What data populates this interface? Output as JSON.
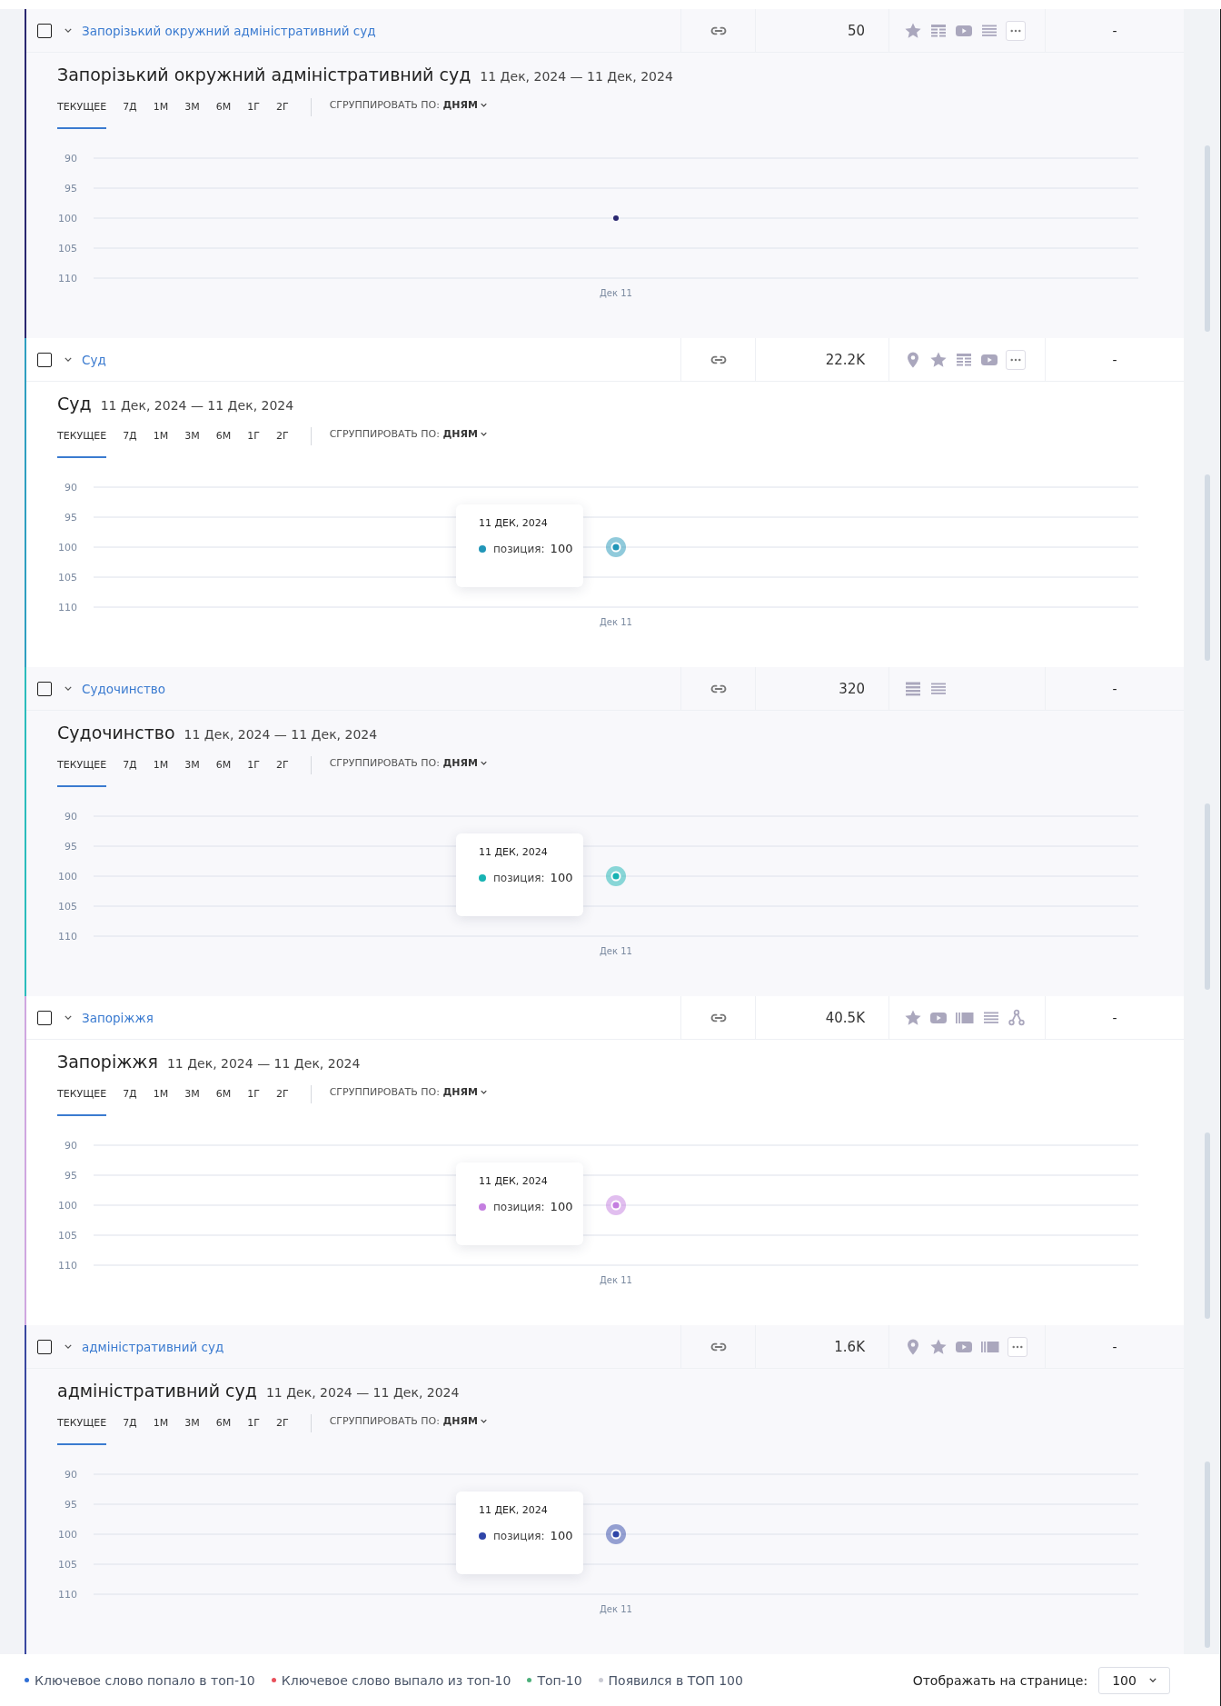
{
  "keywords": [
    {
      "keyword": "Запорізький окружний адміністративний суд",
      "checked": false,
      "expanded": true,
      "volume": "50",
      "features": [
        {
          "kind": "star"
        },
        {
          "kind": "table"
        },
        {
          "kind": "video"
        },
        {
          "kind": "list"
        },
        {
          "kind": "more"
        }
      ],
      "status": "-",
      "color": "#2a2770",
      "title": "Запорізький окружний адміністративний суд",
      "dates": "11 Дек, 2024 — 11 Дек, 2024",
      "periods": [
        {
          "label": "ТЕКУЩЕЕ",
          "selected": true
        },
        {
          "label": "7Д",
          "selected": false
        },
        {
          "label": "1М",
          "selected": false
        },
        {
          "label": "3М",
          "selected": false
        },
        {
          "label": "6М",
          "selected": false
        },
        {
          "label": "1Г",
          "selected": false
        },
        {
          "label": "2Г",
          "selected": false
        }
      ],
      "group_by": "СГРУППИРОВАТЬ ПО: **ДНЯМ**",
      "chart_data": {
        "type": "line",
        "x": [
          "Дек 11"
        ],
        "ylim": [
          110,
          90
        ],
        "yticks": [
          90,
          95,
          100,
          105,
          110
        ],
        "grid": true,
        "series": [
          {
            "color": "#2a2770",
            "marker": true,
            "values": [
              100
            ]
          }
        ]
      }
    },
    {
      "keyword": "Суд",
      "checked": false,
      "expanded": true,
      "volume": "22.2K",
      "features": [
        {
          "kind": "pin"
        },
        {
          "kind": "star"
        },
        {
          "kind": "table"
        },
        {
          "kind": "video"
        },
        {
          "kind": "more"
        }
      ],
      "status": "-",
      "color": "#2f9fc0",
      "title": "Суд",
      "dates": "11 Дек, 2024 — 11 Дек, 2024",
      "periods": [
        {
          "label": "ТЕКУЩЕЕ",
          "selected": true
        },
        {
          "label": "7Д",
          "selected": false
        },
        {
          "label": "1М",
          "selected": false
        },
        {
          "label": "3М",
          "selected": false
        },
        {
          "label": "6М",
          "selected": false
        },
        {
          "label": "1Г",
          "selected": false
        },
        {
          "label": "2Г",
          "selected": false
        }
      ],
      "group_by": "СГРУППИРОВАТЬ ПО: **ДНЯМ**",
      "chart_data": {
        "type": "line",
        "x": [
          "Дек 11"
        ],
        "ylim": [
          110,
          90
        ],
        "yticks": [
          90,
          95,
          100,
          105,
          110
        ],
        "grid": true,
        "series": [
          {
            "color": "#2196b8",
            "marker": true,
            "values": [
              100
            ]
          }
        ]
      },
      "tooltip": {
        "date": "11 ДЕК, 2024",
        "label": "позиция:",
        "value": "100"
      }
    },
    {
      "keyword": "Судочинство",
      "checked": false,
      "expanded": true,
      "volume": "320",
      "features": [
        {
          "kind": "lines"
        },
        {
          "kind": "list"
        }
      ],
      "status": "-",
      "color": "#2bbcbc",
      "title": "Судочинство",
      "dates": "11 Дек, 2024 — 11 Дек, 2024",
      "periods": [
        {
          "label": "ТЕКУЩЕЕ",
          "selected": true
        },
        {
          "label": "7Д",
          "selected": false
        },
        {
          "label": "1М",
          "selected": false
        },
        {
          "label": "3М",
          "selected": false
        },
        {
          "label": "6М",
          "selected": false
        },
        {
          "label": "1Г",
          "selected": false
        },
        {
          "label": "2Г",
          "selected": false
        }
      ],
      "group_by": "СГРУППИРОВАТЬ ПО: **ДНЯМ**",
      "chart_data": {
        "type": "line",
        "x": [
          "Дек 11"
        ],
        "ylim": [
          110,
          90
        ],
        "yticks": [
          90,
          95,
          100,
          105,
          110
        ],
        "grid": true,
        "series": [
          {
            "color": "#17b3b3",
            "marker": true,
            "values": [
              100
            ]
          }
        ]
      },
      "tooltip": {
        "date": "11 ДЕК, 2024",
        "label": "позиция:",
        "value": "100"
      }
    },
    {
      "keyword": "Запоріжжя",
      "checked": false,
      "expanded": true,
      "volume": "40.5K",
      "features": [
        {
          "kind": "star"
        },
        {
          "kind": "video"
        },
        {
          "kind": "gallery"
        },
        {
          "kind": "list"
        },
        {
          "kind": "network"
        }
      ],
      "status": "-",
      "color": "#cfa6e0",
      "title": "Запоріжжя",
      "dates": "11 Дек, 2024 — 11 Дек, 2024",
      "periods": [
        {
          "label": "ТЕКУЩЕЕ",
          "selected": true
        },
        {
          "label": "7Д",
          "selected": false
        },
        {
          "label": "1М",
          "selected": false
        },
        {
          "label": "3М",
          "selected": false
        },
        {
          "label": "6М",
          "selected": false
        },
        {
          "label": "1Г",
          "selected": false
        },
        {
          "label": "2Г",
          "selected": false
        }
      ],
      "group_by": "СГРУППИРОВАТЬ ПО: **ДНЯМ**",
      "chart_data": {
        "type": "line",
        "x": [
          "Дек 11"
        ],
        "ylim": [
          110,
          90
        ],
        "yticks": [
          90,
          95,
          100,
          105,
          110
        ],
        "grid": true,
        "series": [
          {
            "color": "#c47ee0",
            "marker": true,
            "values": [
              100
            ]
          }
        ]
      },
      "tooltip": {
        "date": "11 ДЕК, 2024",
        "label": "позиция:",
        "value": "100"
      }
    },
    {
      "keyword": "адміністративний суд",
      "checked": false,
      "expanded": true,
      "volume": "1.6K",
      "features": [
        {
          "kind": "pin"
        },
        {
          "kind": "star"
        },
        {
          "kind": "video"
        },
        {
          "kind": "gallery"
        },
        {
          "kind": "more"
        }
      ],
      "status": "-",
      "color": "#3a47a0",
      "title": "адміністративний суд",
      "dates": "11 Дек, 2024 — 11 Дек, 2024",
      "periods": [
        {
          "label": "ТЕКУЩЕЕ",
          "selected": true
        },
        {
          "label": "7Д",
          "selected": false
        },
        {
          "label": "1М",
          "selected": false
        },
        {
          "label": "3М",
          "selected": false
        },
        {
          "label": "6М",
          "selected": false
        },
        {
          "label": "1Г",
          "selected": false
        },
        {
          "label": "2Г",
          "selected": false
        }
      ],
      "group_by": "СГРУППИРОВАТЬ ПО: **ДНЯМ**",
      "chart_data": {
        "type": "line",
        "x": [
          "Дек 11"
        ],
        "ylim": [
          110,
          90
        ],
        "yticks": [
          90,
          95,
          100,
          105,
          110
        ],
        "grid": true,
        "series": [
          {
            "color": "#2f45a8",
            "marker": true,
            "values": [
              100
            ]
          }
        ]
      },
      "tooltip": {
        "date": "11 ДЕК, 2024",
        "label": "позиция:",
        "value": "100"
      }
    }
  ],
  "legend": [
    {
      "label": "Ключевое слово попало в топ-10",
      "color": "#2f6fd6"
    },
    {
      "label": "Ключевое слово выпало из топ-10",
      "color": "#e8505b"
    },
    {
      "label": "Топ-10",
      "color": "#4caf7a"
    },
    {
      "label": "Появился в ТОП 100",
      "color": "#c9cad3"
    }
  ],
  "page_size": {
    "label": "Отображать на странице:",
    "value": "100"
  }
}
